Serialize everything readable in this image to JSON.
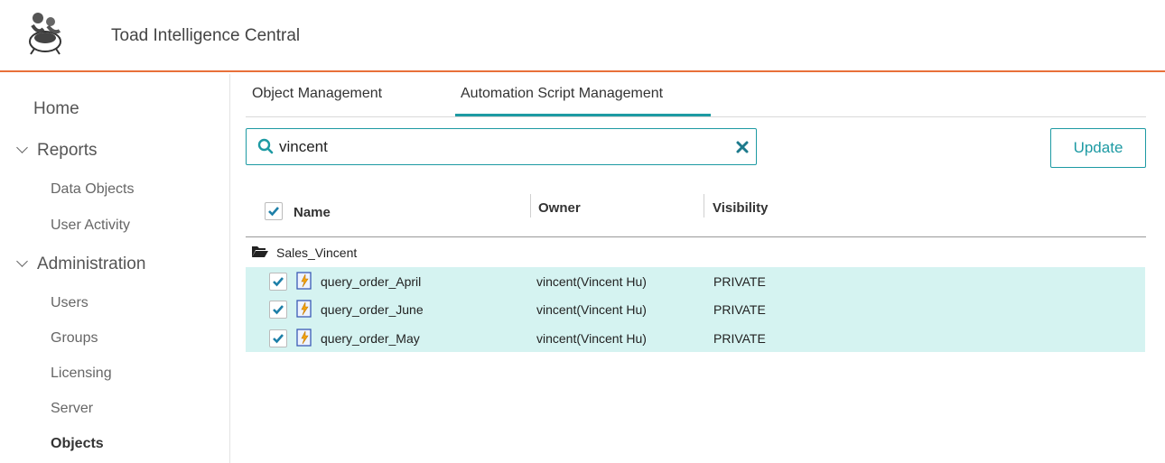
{
  "app": {
    "title": "Toad Intelligence Central"
  },
  "sidebar": {
    "home": "Home",
    "reports": {
      "label": "Reports",
      "items": [
        "Data Objects",
        "User Activity"
      ]
    },
    "administration": {
      "label": "Administration",
      "items": [
        "Users",
        "Groups",
        "Licensing",
        "Server",
        "Objects"
      ]
    }
  },
  "tabs": [
    {
      "label": "Object Management",
      "active": false
    },
    {
      "label": "Automation Script Management",
      "active": true
    }
  ],
  "search": {
    "value": "vincent"
  },
  "update_label": "Update",
  "table": {
    "columns": [
      "Name",
      "Owner",
      "Visibility"
    ],
    "folder": "Sales_Vincent",
    "rows": [
      {
        "name": "query_order_April",
        "owner": "vincent(Vincent Hu)",
        "visibility": "PRIVATE",
        "checked": true
      },
      {
        "name": "query_order_June",
        "owner": "vincent(Vincent Hu)",
        "visibility": "PRIVATE",
        "checked": true
      },
      {
        "name": "query_order_May",
        "owner": "vincent(Vincent Hu)",
        "visibility": "PRIVATE",
        "checked": true
      }
    ]
  },
  "colors": {
    "accent": "#1d9aa3",
    "header_rule": "#e8703a",
    "row_highlight": "#d5f3f1",
    "check": "#1d7fa8"
  },
  "icons": [
    "toad-logo-icon",
    "chevron-down-icon",
    "search-icon",
    "clear-icon",
    "check-icon",
    "folder-open-icon",
    "script-icon"
  ]
}
